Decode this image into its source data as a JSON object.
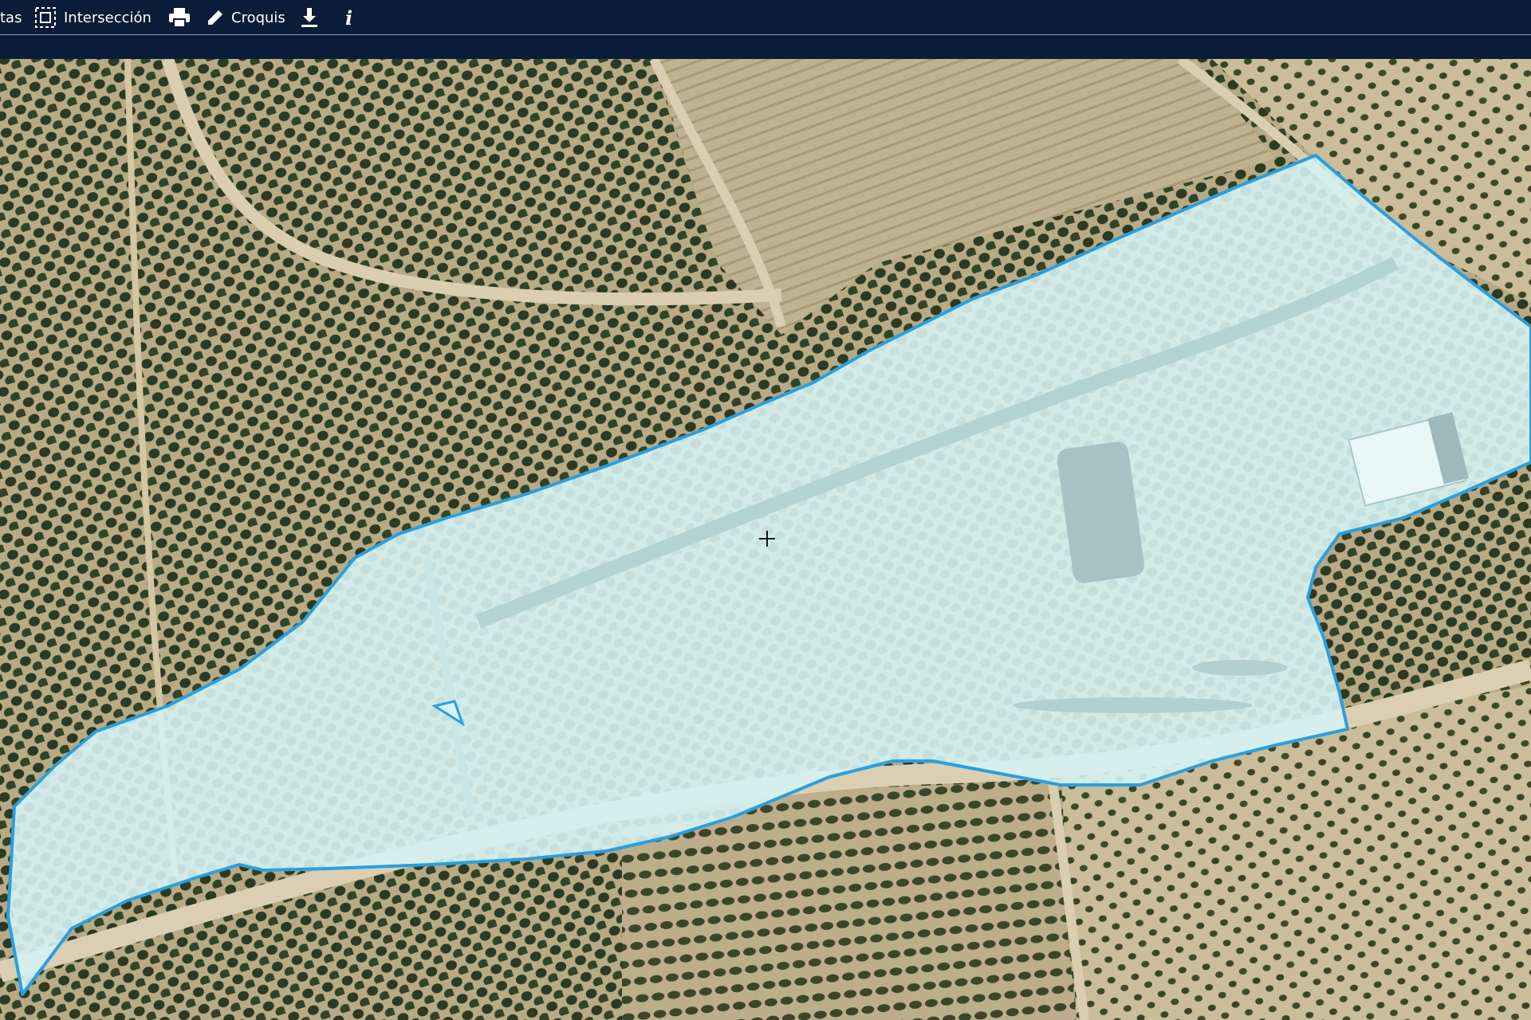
{
  "toolbar": {
    "items": [
      {
        "label": "tas",
        "icon": "none"
      },
      {
        "label": "Intersección",
        "icon": "intersection-icon"
      },
      {
        "label": "",
        "icon": "print-icon"
      },
      {
        "label": "Croquis",
        "icon": "pencil-icon"
      },
      {
        "label": "",
        "icon": "download-icon"
      },
      {
        "label": "",
        "icon": "info-icon"
      }
    ]
  },
  "map": {
    "type": "aerial orthophoto",
    "selected_parcel": {
      "fill_color": "#d6f2f2",
      "outline_color": "#2a9fe0"
    },
    "cursor": "crosshair-icon"
  },
  "colors": {
    "toolbar_bg": "#0b1c38",
    "ground": "#c6b895",
    "tree": "#2f3a22",
    "path": "#d9ceb0"
  }
}
